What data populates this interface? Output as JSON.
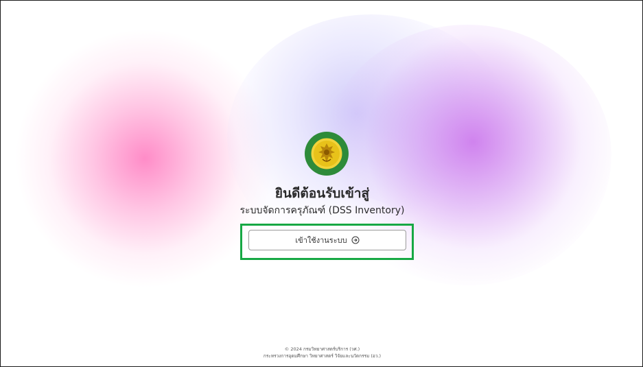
{
  "welcome": {
    "title": "ยินดีต้อนรับเข้าสู่",
    "subtitle": "ระบบจัดการครุภัณฑ์ (DSS Inventory)"
  },
  "login_button": {
    "label": "เข้าใช้งานระบบ",
    "icon": "arrow-circle-right-icon"
  },
  "footer": {
    "line1": "© 2024 กรมวิทยาศาสตร์บริการ (วศ.)",
    "line2": "กระทรวงการอุดมศึกษา วิทยาศาสตร์ วิจัยและนวัตกรรม (อว.)"
  },
  "colors": {
    "highlight": "#17a844",
    "logo_green": "#2e8b3a",
    "logo_yellow": "#e8c21a",
    "blob_pink": "#ff78be",
    "blob_purple": "#c86eeb",
    "blob_blue": "#aaa0f5"
  }
}
